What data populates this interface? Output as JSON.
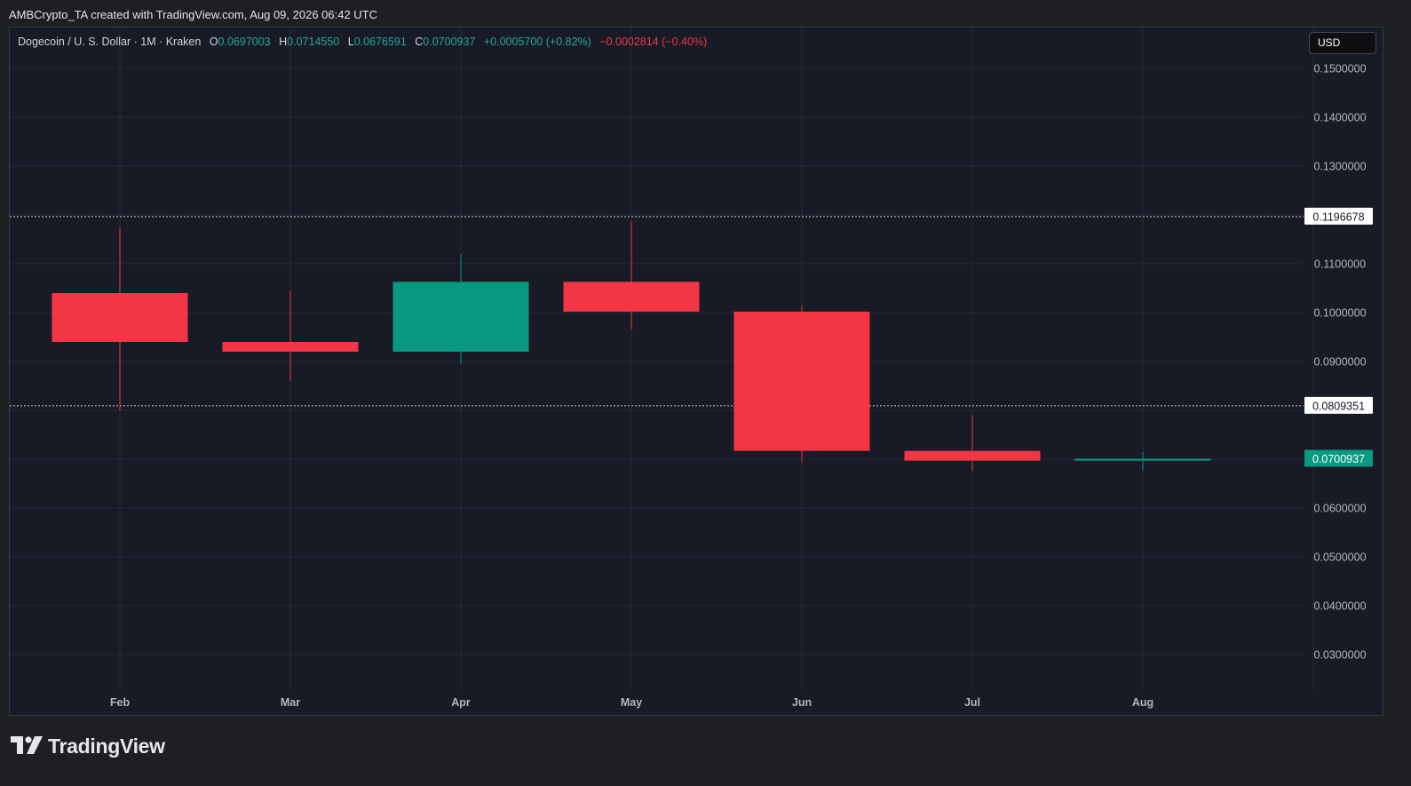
{
  "credit": "AMBCrypto_TA created with TradingView.com, Aug 09, 2026 06:42 UTC",
  "legend": {
    "symbol": "Dogecoin / U. S. Dollar · 1M · Kraken",
    "o_label": "O",
    "o_value": "0.0697003",
    "h_label": "H",
    "h_value": "0.0714550",
    "l_label": "L",
    "l_value": "0.0676591",
    "c_label": "C",
    "c_value": "0.0700937",
    "change": "+0.0005700 (+0.82%)",
    "change2": "−0.0002814 (−0.40%)"
  },
  "currency_button": "USD",
  "logo_text": "TradingView",
  "colors": {
    "background": "#181b25",
    "up": "#089981",
    "down": "#f23645",
    "grid": "#262a36",
    "axis_text": "#b2b5be"
  },
  "chart_data": {
    "type": "candlestick",
    "y_scale": "linear",
    "ylim": [
      0.0225,
      0.155
    ],
    "yticks": [
      {
        "value": 0.15,
        "label": "0.1500000"
      },
      {
        "value": 0.14,
        "label": "0.1400000"
      },
      {
        "value": 0.13,
        "label": "0.1300000"
      },
      {
        "value": 0.11,
        "label": "0.1100000"
      },
      {
        "value": 0.1,
        "label": "0.1000000"
      },
      {
        "value": 0.09,
        "label": "0.0900000"
      },
      {
        "value": 0.06,
        "label": "0.0600000"
      },
      {
        "value": 0.05,
        "label": "0.0500000"
      },
      {
        "value": 0.04,
        "label": "0.0400000"
      },
      {
        "value": 0.03,
        "label": "0.0300000"
      }
    ],
    "x_labels": [
      "Feb",
      "Mar",
      "Apr",
      "May",
      "Jun",
      "Jul",
      "Aug"
    ],
    "grid": true,
    "candles": [
      {
        "month": "Feb",
        "open": 0.104,
        "high": 0.1175,
        "low": 0.08,
        "close": 0.094
      },
      {
        "month": "Mar",
        "open": 0.094,
        "high": 0.1045,
        "low": 0.086,
        "close": 0.092
      },
      {
        "month": "Apr",
        "open": 0.092,
        "high": 0.112,
        "low": 0.0895,
        "close": 0.1063
      },
      {
        "month": "May",
        "open": 0.1063,
        "high": 0.1187,
        "low": 0.0965,
        "close": 0.1002
      },
      {
        "month": "Jun",
        "open": 0.1002,
        "high": 0.1015,
        "low": 0.0693,
        "close": 0.0717
      },
      {
        "month": "Jul",
        "open": 0.0717,
        "high": 0.079,
        "low": 0.0676,
        "close": 0.0697
      },
      {
        "month": "Aug",
        "open": 0.0697003,
        "high": 0.071455,
        "low": 0.0676591,
        "close": 0.0700937
      }
    ],
    "price_lines": [
      {
        "value": 0.1196678,
        "label": "0.1196678",
        "style": "dotted",
        "label_color": "#ffffff"
      },
      {
        "value": 0.0809351,
        "label": "0.0809351",
        "style": "dotted",
        "label_color": "#ffffff"
      }
    ],
    "last_price": {
      "value": 0.0700937,
      "label": "0.0700937",
      "label_color": "#089981"
    }
  }
}
